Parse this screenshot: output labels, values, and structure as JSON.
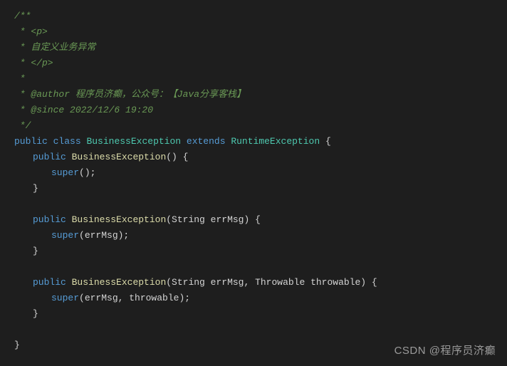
{
  "javadoc": {
    "open": "/**",
    "l1": " * <p>",
    "l2": " * 自定义业务异常",
    "l3": " * </p>",
    "l4": " *",
    "author": " * @author 程序员济癫，公众号：【Java分享客栈】",
    "since": " * @since 2022/12/6 19:20",
    "close": " */"
  },
  "kw": {
    "public": "public",
    "class": "class",
    "extends": "extends",
    "super": "super"
  },
  "cls": {
    "name": "BusinessException",
    "parent": "RuntimeException"
  },
  "sig": {
    "c1_open": "() {",
    "c1_body_open": "();",
    "c2_open": "(String errMsg) {",
    "c2_body": "(errMsg);",
    "c3_open": "(String errMsg, Throwable throwable) {",
    "c3_body": "(errMsg, throwable);"
  },
  "p": {
    "obrace": " {",
    "cbrace": "}",
    "space": " "
  },
  "watermark": "CSDN @程序员济癫"
}
